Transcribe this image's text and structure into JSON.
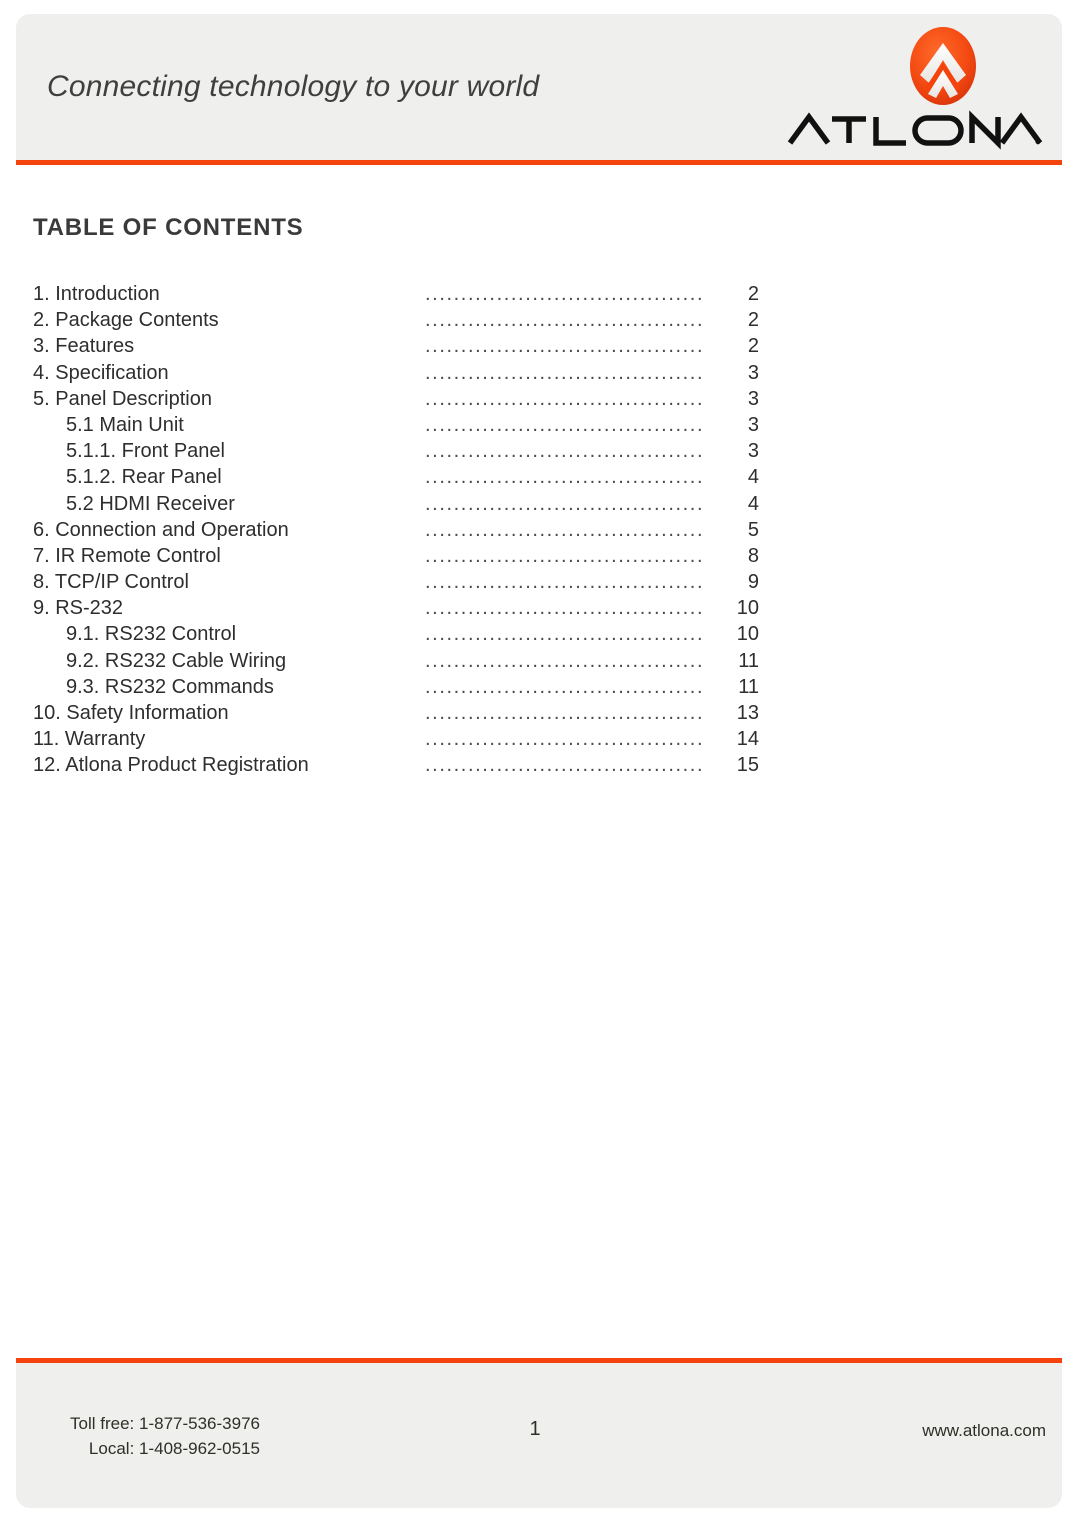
{
  "header": {
    "tagline": "Connecting technology to your world",
    "brand_wordmark": "ATLONA.",
    "logo_icon_name": "atlona-chevron-logo",
    "accent_color": "#f4430d",
    "band_color": "#efefed"
  },
  "toc": {
    "title": "TABLE OF CONTENTS",
    "entries": [
      {
        "label": "1. Introduction",
        "page": "2",
        "level": 1
      },
      {
        "label": "2. Package Contents",
        "page": "2",
        "level": 1
      },
      {
        "label": "3. Features",
        "page": "2",
        "level": 1
      },
      {
        "label": "4. Specification",
        "page": "3",
        "level": 1
      },
      {
        "label": "5. Panel Description",
        "page": "3",
        "level": 1
      },
      {
        "label": "5.1 Main Unit",
        "page": "3",
        "level": 2
      },
      {
        "label": "5.1.1. Front Panel",
        "page": "3",
        "level": 2
      },
      {
        "label": "5.1.2. Rear Panel",
        "page": "4",
        "level": 2
      },
      {
        "label": "5.2 HDMI Receiver",
        "page": "4",
        "level": 2
      },
      {
        "label": "6. Connection and Operation",
        "page": "5",
        "level": 1
      },
      {
        "label": "7. IR Remote Control",
        "page": "8",
        "level": 1
      },
      {
        "label": "8. TCP/IP Control",
        "page": "9",
        "level": 1
      },
      {
        "label": "9. RS-232",
        "page": "10",
        "level": 1
      },
      {
        "label": "9.1. RS232 Control",
        "page": "10",
        "level": 2
      },
      {
        "label": "9.2. RS232 Cable Wiring",
        "page": "11",
        "level": 2
      },
      {
        "label": "9.3. RS232 Commands",
        "page": "11",
        "level": 2
      },
      {
        "label": "10. Safety Information",
        "page": "13",
        "level": 1
      },
      {
        "label": "11. Warranty",
        "page": "14",
        "level": 1
      },
      {
        "label": "12. Atlona Product Registration",
        "page": "15",
        "level": 1
      }
    ],
    "leader": "................................................"
  },
  "footer": {
    "toll_free": "Toll free: 1-877-536-3976",
    "local": "Local: 1-408-962-0515",
    "page_number": "1",
    "website": "www.atlona.com"
  }
}
